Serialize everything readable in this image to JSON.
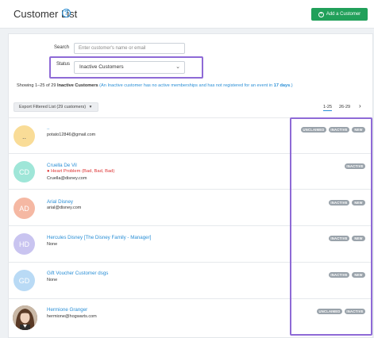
{
  "header": {
    "title": "Customer List",
    "help_icon": "question-circle-icon",
    "add_button_label": "Add a Customer",
    "add_button_icon": "plus-circle-icon",
    "add_button_color": "#21a05a"
  },
  "filters": {
    "search_label": "Search",
    "search_placeholder": "Enter customer's name or email",
    "status_label": "Status",
    "status_value": "Inactive Customers"
  },
  "summary": {
    "prefix": "Showing 1–25 of 29 ",
    "bold": "Inactive Customers",
    "note": " (An Inactive customer has no active memberships and has not registered for an event in ",
    "note_bold": "17 days",
    "note_end": ".)"
  },
  "toolbar": {
    "export_label": "Export Filtered List (29 customers)",
    "export_icon": "caret-down-icon",
    "pages": [
      "1-25",
      "26-29"
    ],
    "next_icon": "chevron-right-icon"
  },
  "accent_colors": {
    "link": "#2a8fd6",
    "badge": "#9aa3ab",
    "highlight": "#8e6ad6"
  },
  "customers": [
    {
      "initials": "..",
      "avatar_color": "#f9dc97",
      "name": "..",
      "email": "potato12846@gmail.com",
      "badges": [
        "UNCLAIMED",
        "INACTIVE",
        "NEW"
      ]
    },
    {
      "initials": "CD",
      "avatar_color": "#9fe6d8",
      "name": "Cruella De Vil",
      "condition": "● Heart Problem (Bad, Bad, Bad)",
      "email": "Cruella@disney.com",
      "badges": [
        "INACTIVE"
      ]
    },
    {
      "initials": "AD",
      "avatar_color": "#f5b8a3",
      "name": "Arial Disney",
      "email": "arial@disney.com",
      "badges": [
        "INACTIVE",
        "NEW"
      ]
    },
    {
      "initials": "HD",
      "avatar_color": "#c9c4f0",
      "name": "Hercules Disney [The Disney Family - Manager]",
      "email": "None",
      "badges": [
        "INACTIVE",
        "NEW"
      ]
    },
    {
      "initials": "GD",
      "avatar_color": "#b9daf5",
      "name": "Gift Voucher Customer dsgs",
      "email": "None",
      "badges": [
        "INACTIVE",
        "NEW"
      ]
    },
    {
      "initials": "",
      "avatar_color": "#6b4a35",
      "name": "Hermione Granger",
      "email": "hermione@hogwarts.com",
      "badges": [
        "UNCLAIMED",
        "INACTIVE"
      ]
    }
  ]
}
